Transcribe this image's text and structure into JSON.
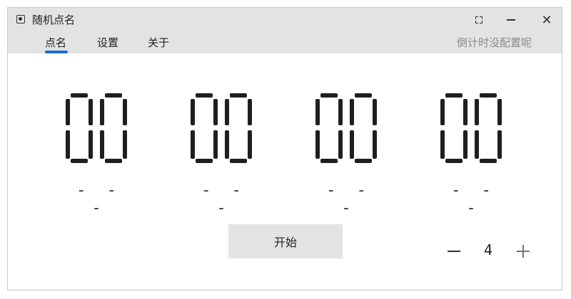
{
  "window": {
    "title": "随机点名",
    "controls": {
      "maximize_icon": "maximize-icon",
      "minimize_icon": "minimize-icon",
      "close_icon": "close-icon",
      "close_glyph": "✕"
    }
  },
  "tabs": [
    {
      "label": "点名",
      "active": true
    },
    {
      "label": "设置",
      "active": false
    },
    {
      "label": "关于",
      "active": false
    }
  ],
  "status": {
    "text": "倒计时没配置呢"
  },
  "slots": [
    {
      "digits": "00",
      "name": "- - -"
    },
    {
      "digits": "00",
      "name": "- - -"
    },
    {
      "digits": "00",
      "name": "- - -"
    },
    {
      "digits": "00",
      "name": "- - -"
    }
  ],
  "start_button": {
    "label": "开始"
  },
  "count_stepper": {
    "value": "4",
    "minus_icon": "minus-icon",
    "plus_icon": "plus-icon"
  },
  "colors": {
    "accent": "#1a6fd0",
    "titlebar": "#e3e3e3",
    "segment": "#1f1f1f",
    "button": "#e4e4e4"
  }
}
